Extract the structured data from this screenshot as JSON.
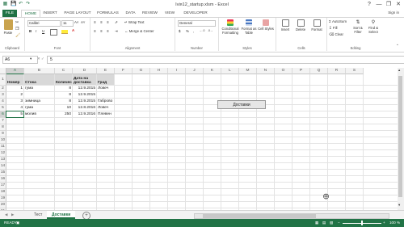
{
  "window": {
    "title": "Iviя12_startup.xlsm - Excel",
    "controls": [
      "?",
      "—",
      "❐",
      "✕"
    ]
  },
  "ribbon_tabs": [
    "FILE",
    "HOME",
    "INSERT",
    "PAGE LAYOUT",
    "FORMULAS",
    "DATA",
    "REVIEW",
    "VIEW",
    "DEVELOPER"
  ],
  "sign_in": "Sign in",
  "ribbon": {
    "clipboard": {
      "paste": "Paste",
      "label": "Clipboard"
    },
    "font": {
      "name": "Calibri",
      "size": "11",
      "bold": "B",
      "italic": "I",
      "underline": "U",
      "grow": "A˄",
      "shrink": "A˅",
      "label": "Font"
    },
    "alignment": {
      "wrap": "Wrap Text",
      "merge": "Merge & Center",
      "label": "Alignment"
    },
    "number": {
      "format": "General",
      "label": "Number",
      "currency": "$",
      "percent": "%",
      "comma": ","
    },
    "styles": {
      "conditional": "Conditional Formatting",
      "format_table": "Format as Table",
      "cell_styles": "Cell Styles",
      "label": "Styles"
    },
    "cells": {
      "insert": "Insert",
      "delete": "Delete",
      "format": "Format",
      "label": "Cells"
    },
    "editing": {
      "autosum": "AutoSum",
      "fill": "Fill",
      "clear": "Clear",
      "sort": "Sort & Filter",
      "find": "Find & Select",
      "label": "Editing"
    }
  },
  "formula_bar": {
    "name_box": "A6",
    "fx": "fx",
    "cancel": "✕",
    "enter": "✓",
    "value": "5"
  },
  "columns": [
    "A",
    "B",
    "C",
    "D",
    "E",
    "F",
    "G",
    "H",
    "I",
    "J",
    "K",
    "L",
    "M",
    "N",
    "O",
    "P",
    "Q",
    "R",
    "S"
  ],
  "rows": [
    "1",
    "2",
    "3",
    "4",
    "5",
    "6",
    "7",
    "8",
    "9",
    "10",
    "11",
    "12",
    "13",
    "14",
    "15",
    "16",
    "17",
    "18",
    "19",
    "20",
    "21",
    "22",
    "23",
    "24"
  ],
  "table": {
    "headers": [
      "Номер",
      "Стока",
      "Количество",
      "Дата на доставка",
      "Град"
    ],
    "rows": [
      [
        "1",
        "гума",
        "8",
        "12.9.2015",
        "Ловеч"
      ],
      [
        "2",
        "",
        "8",
        "12.9.2015",
        ""
      ],
      [
        "3",
        "зимница",
        "8",
        "12.9.2015",
        "Габрово"
      ],
      [
        "4",
        "гума",
        "10",
        "12.8.2016",
        "Ловеч"
      ],
      [
        "5",
        "молив",
        "250",
        "12.9.2016",
        "Плевен"
      ]
    ]
  },
  "macro_button": "Доставки",
  "sheets": [
    "Тест",
    "Доставки"
  ],
  "active_sheet": "Доставки",
  "add_sheet": "+",
  "status": {
    "mode": "READY",
    "zoom": "100 %"
  },
  "colors": {
    "accent": "#217346",
    "header_fill": "#d8d8d8"
  }
}
